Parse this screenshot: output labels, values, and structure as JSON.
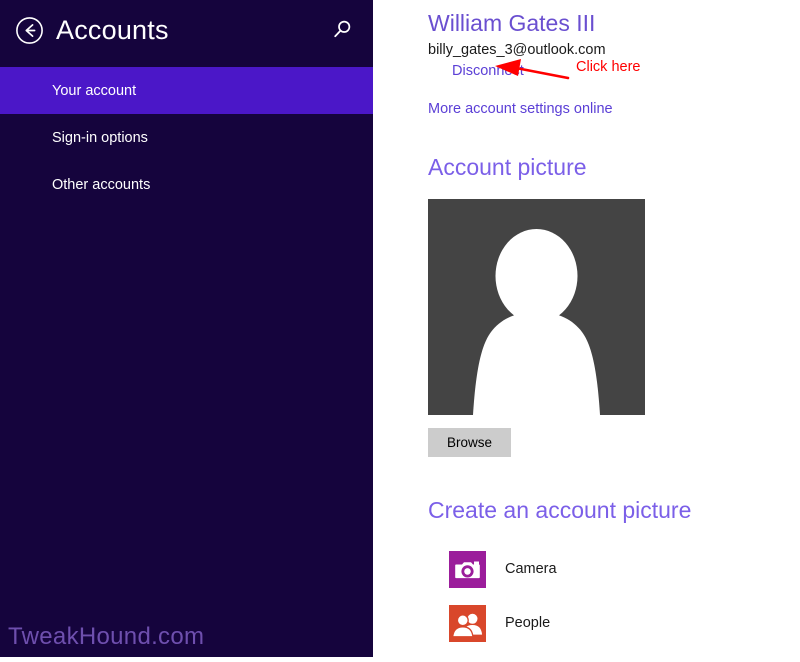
{
  "sidebar": {
    "back_icon": "back-arrow-circle-icon",
    "title": "Accounts",
    "search_icon": "search-icon",
    "items": [
      {
        "label": "Your account",
        "selected": true
      },
      {
        "label": "Sign-in options",
        "selected": false
      },
      {
        "label": "Other accounts",
        "selected": false
      }
    ],
    "watermark": "TweakHound.com",
    "colors": {
      "background": "#15043D",
      "selected": "#4B17C8",
      "text": "#FFFFFF",
      "watermark": "#6E4FAE"
    }
  },
  "content": {
    "account": {
      "name": "William Gates III",
      "email": "billy_gates_3@outlook.com",
      "disconnect_label": "Disconnect",
      "more_settings_label": "More account settings online"
    },
    "account_picture": {
      "heading": "Account picture",
      "avatar_icon": "person-silhouette-icon",
      "browse_label": "Browse"
    },
    "create_picture": {
      "heading": "Create an account picture",
      "tiles": [
        {
          "label": "Camera",
          "icon": "camera-icon",
          "color": "#9B1D9B"
        },
        {
          "label": "People",
          "icon": "people-icon",
          "color": "#D9472B"
        }
      ]
    },
    "colors": {
      "name": "#6A4FD0",
      "heading": "#7B5FE8",
      "link": "#5B3FD6",
      "email": "#1A1A1A",
      "avatar_bg": "#444444",
      "browse_bg": "#CCCCCC"
    }
  },
  "annotation": {
    "text": "Click here",
    "color": "#FF0000",
    "arrow_icon": "red-arrow-pointing-left-icon"
  }
}
